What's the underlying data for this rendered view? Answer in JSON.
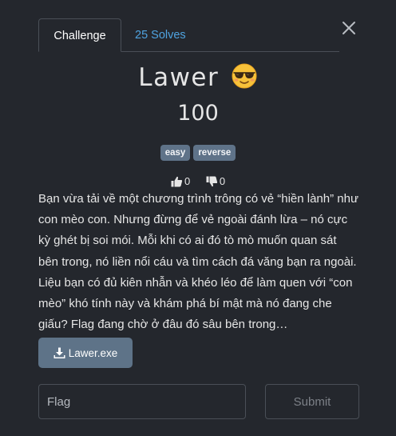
{
  "tabs": [
    {
      "label": "Challenge",
      "active": true
    },
    {
      "label": "25 Solves",
      "active": false
    }
  ],
  "challenge": {
    "name": "Lawer",
    "emoji_icon": "sunglasses-face-icon",
    "value": "100",
    "tags": [
      "easy",
      "reverse"
    ],
    "upvotes": "0",
    "downvotes": "0",
    "description": "Bạn vừa tải về một chương trình trông có vẻ “hiền lành” như con mèo con. Nhưng đừng để vẻ ngoài đánh lừa – nó cực kỳ ghét bị soi mói. Mỗi khi có ai đó tò mò muốn quan sát bên trong, nó liền nổi cáu và tìm cách đá văng bạn ra ngoài. Liệu bạn có đủ kiên nhẫn và khéo léo để làm quen với “con mèo” khó tính này và khám phá bí mật mà nó đang che giấu? Flag đang chờ ở đâu đó sâu bên trong…"
  },
  "file": {
    "label": "Lawer.exe",
    "icon": "download-icon"
  },
  "submission": {
    "placeholder": "Flag",
    "value": "",
    "submit_label": "Submit"
  },
  "colors": {
    "background": "#24272d",
    "accent_link": "#4fa3e0",
    "tag_bg": "#5f7389",
    "button_bg": "#5e7388",
    "border": "#4a4f57"
  }
}
